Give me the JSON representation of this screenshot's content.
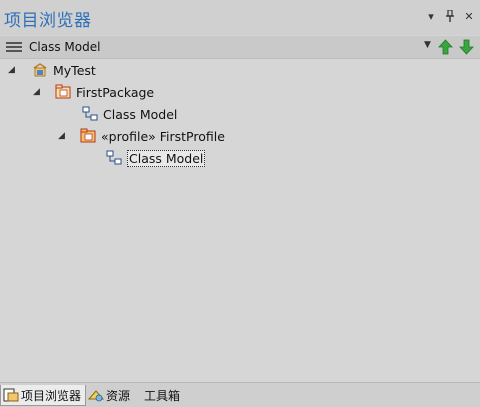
{
  "window": {
    "title": "项目浏览器",
    "controls": [
      "▾",
      "ꟼ",
      "✕"
    ]
  },
  "toolbar": {
    "label": "Class Model"
  },
  "tree": {
    "root": {
      "label": "MyTest"
    },
    "package": {
      "label": "FirstPackage"
    },
    "model1": {
      "label": "Class Model"
    },
    "profile": {
      "label": "«profile» FirstProfile"
    },
    "model2": {
      "label": "Class Model"
    }
  },
  "tabs": [
    {
      "label": "项目浏览器"
    },
    {
      "label": "资源"
    },
    {
      "label": "工具箱"
    }
  ],
  "colors": {
    "title": "#2f6fb8",
    "arrow_green": "#3aa540",
    "selection_bg": "#e8e8e8"
  }
}
